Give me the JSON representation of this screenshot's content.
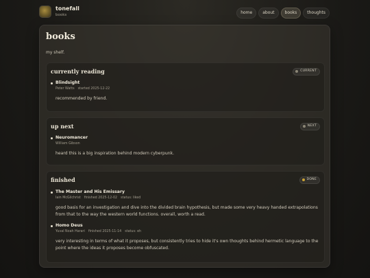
{
  "site": {
    "name": "tonefall",
    "subtitle": "books"
  },
  "nav": [
    {
      "label": "home",
      "active": false
    },
    {
      "label": "about",
      "active": false
    },
    {
      "label": "books",
      "active": true
    },
    {
      "label": "thoughts",
      "active": false
    }
  ],
  "page": {
    "title": "books",
    "description": "my shelf."
  },
  "sections": {
    "reading": {
      "title": "currently reading",
      "badge": "CURRENT",
      "badge_color": "#8c8777",
      "books": [
        {
          "title": "Blindsight",
          "author": "Peter Watts",
          "status": "started 2025-12-22",
          "note": "recommended by friend."
        }
      ]
    },
    "next": {
      "title": "up next",
      "badge": "NEXT",
      "badge_color": "#8c8777",
      "books": [
        {
          "title": "Neuromancer",
          "author": "William Gibson",
          "note": "heard this is a big inspiration behind modern cyberpunk."
        }
      ]
    },
    "finished": {
      "title": "finished",
      "badge": "DONE",
      "badge_color": "#c9a235",
      "books": [
        {
          "title": "The Master and His Emissary",
          "author": "Iain McGilchrist",
          "finished": "finished 2025-12-02",
          "status": "status: liked",
          "note": "good basis for an investigation and dive into the divided brain hypothesis, but made some very heavy handed extrapolations from that to the way the western world functions. overall, worth a read."
        },
        {
          "title": "Homo Deus",
          "author": "Yuval Noah Harari",
          "finished": "finished 2025-11-14",
          "status": "status: eh",
          "note": "very interesting in terms of what it proposes, but consistently tries to hide it's own thoughts behind hermetic language to the point where the ideas it proposes become obfuscated."
        }
      ]
    }
  },
  "icons": {
    "logo": "tonefall-logo",
    "badge_dot": "status-dot"
  }
}
